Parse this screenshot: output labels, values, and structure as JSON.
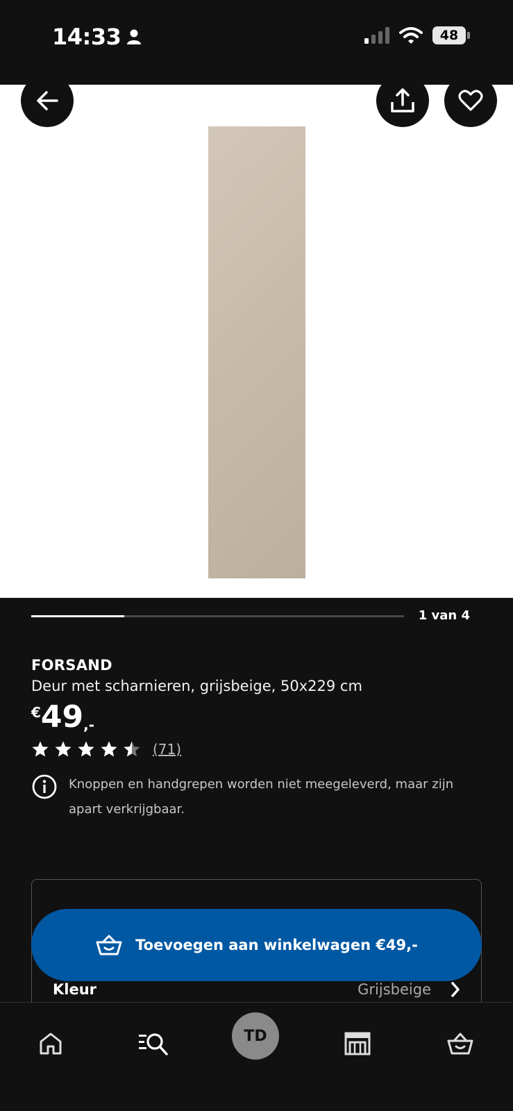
{
  "status_bar": {
    "time": "14:33",
    "battery": "48"
  },
  "hero": {
    "back_icon": "arrow-left-icon",
    "share_icon": "share-icon",
    "favorite_icon": "heart-icon"
  },
  "carousel": {
    "position_text": "1 van 4",
    "progress": 0.25
  },
  "product": {
    "brand": "FORSAND",
    "description": "Deur met scharnieren, grijsbeige, 50x229 cm",
    "price": {
      "currency": "€",
      "integer": "49",
      "decimal": ",-"
    },
    "rating": 4.5,
    "review_count": "(71)",
    "notice": "Knoppen en handgrepen worden niet meegeleverd, maar zijn apart verkrijgbaar."
  },
  "option": {
    "label": "Kleur",
    "value": "Grijsbeige"
  },
  "cta": {
    "label": "Toevoegen aan winkelwagen €49,-"
  },
  "bottom_nav": {
    "items": [
      "home-icon",
      "search-icon",
      "profile-avatar",
      "store-icon",
      "cart-icon"
    ],
    "profile_initials": "TD"
  },
  "colors": {
    "cta": "#0058a3",
    "background": "#111111",
    "door": "#c9bdab"
  }
}
